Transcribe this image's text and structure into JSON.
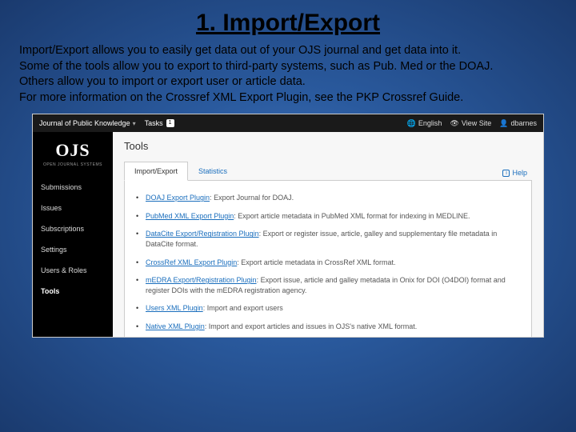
{
  "slide": {
    "title": "1.  Import/Export",
    "description": "Import/Export allows you to easily get data out of your OJS journal and get data into it.\nSome of the tools allow you to export to third-party systems, such as Pub. Med or the DOAJ.\nOthers allow you to import or export user or article data.\nFor more information on the Crossref XML Export Plugin, see the PKP Crossref Guide."
  },
  "topbar": {
    "journal": "Journal of Public Knowledge",
    "tasks_label": "Tasks",
    "tasks_count": "1",
    "language": "English",
    "view_site": "View Site",
    "username": "dbarnes"
  },
  "sidebar": {
    "logo": "OJS",
    "logo_sub": "OPEN JOURNAL SYSTEMS",
    "items": [
      {
        "label": "Submissions"
      },
      {
        "label": "Issues"
      },
      {
        "label": "Subscriptions"
      },
      {
        "label": "Settings"
      },
      {
        "label": "Users & Roles"
      },
      {
        "label": "Tools"
      }
    ]
  },
  "main": {
    "heading": "Tools",
    "tabs": [
      {
        "label": "Import/Export",
        "active": true
      },
      {
        "label": "Statistics",
        "active": false
      }
    ],
    "help_label": "Help",
    "plugins": [
      {
        "name": "DOAJ Export Plugin",
        "desc": "Export Journal for DOAJ."
      },
      {
        "name": "PubMed XML Export Plugin",
        "desc": "Export article metadata in PubMed XML format for indexing in MEDLINE."
      },
      {
        "name": "DataCite Export/Registration Plugin",
        "desc": "Export or register issue, article, galley and supplementary file metadata in DataCite format."
      },
      {
        "name": "CrossRef XML Export Plugin",
        "desc": "Export article metadata in CrossRef XML format."
      },
      {
        "name": "mEDRA Export/Registration Plugin",
        "desc": "Export issue, article and galley metadata in Onix for DOI (O4DOI) format and register DOIs with the mEDRA registration agency."
      },
      {
        "name": "Users XML Plugin",
        "desc": "Import and export users"
      },
      {
        "name": "Native XML Plugin",
        "desc": "Import and export articles and issues in OJS's native XML format."
      }
    ]
  }
}
